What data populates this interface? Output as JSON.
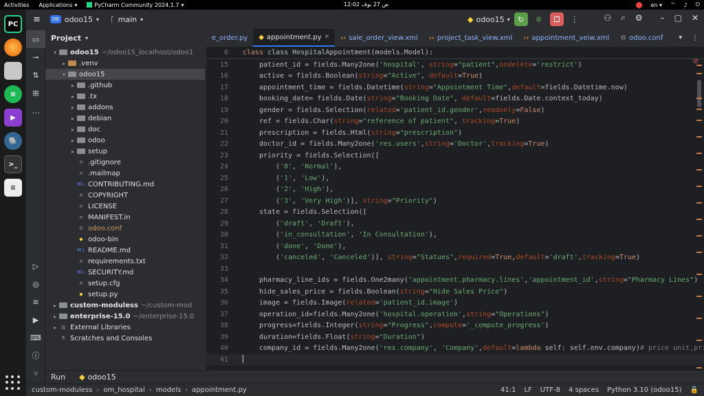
{
  "system_bar": {
    "activities": "Activities",
    "applications": "Applications",
    "active_app": "PyCharm Community 2024.1.7",
    "clock": "12:02 ص  27 نوف",
    "lang": "en"
  },
  "toolbar": {
    "project_badge": "OE",
    "project_name": "odoo15",
    "branch": "main",
    "run_config": "odoo15"
  },
  "project_panel": {
    "title": "Project",
    "tree": [
      {
        "indent": 0,
        "arrow": "▾",
        "kind": "folder",
        "label": "odoo15",
        "hint": "~/odoo15_localhost/odoo1",
        "bold": true
      },
      {
        "indent": 1,
        "arrow": "▸",
        "kind": "folder",
        "label": ".venv",
        "hint": "",
        "orange": true
      },
      {
        "indent": 1,
        "arrow": "▾",
        "kind": "folder",
        "label": "odoo15",
        "hint": "",
        "sel": true
      },
      {
        "indent": 2,
        "arrow": "▸",
        "kind": "folder",
        "label": ".github",
        "hint": ""
      },
      {
        "indent": 2,
        "arrow": "▸",
        "kind": "folder",
        "label": ".tx",
        "hint": ""
      },
      {
        "indent": 2,
        "arrow": "▸",
        "kind": "folder",
        "label": "addons",
        "hint": ""
      },
      {
        "indent": 2,
        "arrow": "▸",
        "kind": "folder",
        "label": "debian",
        "hint": ""
      },
      {
        "indent": 2,
        "arrow": "▸",
        "kind": "folder",
        "label": "doc",
        "hint": ""
      },
      {
        "indent": 2,
        "arrow": "▸",
        "kind": "folder",
        "label": "odoo",
        "hint": ""
      },
      {
        "indent": 2,
        "arrow": "▸",
        "kind": "folder",
        "label": "setup",
        "hint": ""
      },
      {
        "indent": 2,
        "arrow": "",
        "kind": "ignore",
        "label": ".gitignore",
        "hint": ""
      },
      {
        "indent": 2,
        "arrow": "",
        "kind": "text",
        "label": ".mailmap",
        "hint": ""
      },
      {
        "indent": 2,
        "arrow": "",
        "kind": "md",
        "label": "CONTRIBUTING.md",
        "hint": ""
      },
      {
        "indent": 2,
        "arrow": "",
        "kind": "text",
        "label": "COPYRIGHT",
        "hint": ""
      },
      {
        "indent": 2,
        "arrow": "",
        "kind": "text",
        "label": "LICENSE",
        "hint": ""
      },
      {
        "indent": 2,
        "arrow": "",
        "kind": "text",
        "label": "MANIFEST.in",
        "hint": ""
      },
      {
        "indent": 2,
        "arrow": "",
        "kind": "conf",
        "label": "odoo.conf",
        "hint": "",
        "orange": true
      },
      {
        "indent": 2,
        "arrow": "",
        "kind": "py",
        "label": "odoo-bin",
        "hint": ""
      },
      {
        "indent": 2,
        "arrow": "",
        "kind": "md",
        "label": "README.md",
        "hint": ""
      },
      {
        "indent": 2,
        "arrow": "",
        "kind": "text",
        "label": "requirements.txt",
        "hint": ""
      },
      {
        "indent": 2,
        "arrow": "",
        "kind": "md",
        "label": "SECURITY.md",
        "hint": ""
      },
      {
        "indent": 2,
        "arrow": "",
        "kind": "text",
        "label": "setup.cfg",
        "hint": ""
      },
      {
        "indent": 2,
        "arrow": "",
        "kind": "py",
        "label": "setup.py",
        "hint": ""
      },
      {
        "indent": 0,
        "arrow": "▸",
        "kind": "folder",
        "label": "custom-moduless",
        "hint": "~/custom-mod",
        "bold": true
      },
      {
        "indent": 0,
        "arrow": "▸",
        "kind": "folder",
        "label": "enterprise-15.0",
        "hint": "~/enterprise-15.0",
        "bold": true
      },
      {
        "indent": 0,
        "arrow": "▸",
        "kind": "lib",
        "label": "External Libraries",
        "hint": ""
      },
      {
        "indent": 0,
        "arrow": "",
        "kind": "scratch",
        "label": "Scratches and Consoles",
        "hint": ""
      }
    ]
  },
  "tabs": [
    {
      "label": "e_order.py",
      "icon": "",
      "active": false
    },
    {
      "label": "appointment.py",
      "icon": "py",
      "active": true
    },
    {
      "label": "sale_order_view.xml",
      "icon": "xml",
      "active": false
    },
    {
      "label": "project_task_view.xml",
      "icon": "xml",
      "active": false
    },
    {
      "label": "appointment_veiw.xml",
      "icon": "xml",
      "active": false
    },
    {
      "label": "odoo.conf",
      "icon": "conf",
      "active": false
    }
  ],
  "sticky": {
    "num": "6",
    "code": "class HospitalAppointment(models.Model):"
  },
  "code_lines": [
    {
      "n": "15",
      "html": "patient_id = fields.Many2one(<span class=\"s\">'hospital'</span>, <span class=\"p\">string</span>=<span class=\"s\">\"patient\"</span>,<span class=\"p\">ondelete</span>=<span class=\"s\">'restrict'</span>)"
    },
    {
      "n": "16",
      "html": "active = fields.Boolean(<span class=\"p\">string</span>=<span class=\"s\">\"Active\"</span>, <span class=\"p\">default</span>=<span class=\"k\">True</span>)"
    },
    {
      "n": "17",
      "html": "appointment_time = fields.Datetime(<span class=\"p\">string</span>=<span class=\"s\">\"Appointment Time\"</span>,<span class=\"p\">default</span>=fields.Datetime.now)"
    },
    {
      "n": "18",
      "html": "booking_date= fields.Date(<span class=\"p\">string</span>=<span class=\"s\">\"Booking Date\"</span>, <span class=\"p\">default</span>=fields.Date.context_today)"
    },
    {
      "n": "19",
      "html": "gender = fields.Selection(<span class=\"p\">related</span>=<span class=\"s\">'patient_id.gender'</span>,<span class=\"p\">readonly</span>=<span class=\"k\">False</span>)"
    },
    {
      "n": "20",
      "html": "ref = fields.Char(<span class=\"p\">string</span>=<span class=\"s\">\"reference of patient\"</span>, <span class=\"p\">tracking</span>=<span class=\"k\">True</span>)"
    },
    {
      "n": "21",
      "html": "prescription = fields.Html(<span class=\"p\">string</span>=<span class=\"s\">\"prescription\"</span>)"
    },
    {
      "n": "22",
      "html": "doctor_id = fields.Many2one(<span class=\"s\">'res.users'</span>,<span class=\"p\">string</span>=<span class=\"s\">'Doctor'</span>,<span class=\"p\">tracking</span>=<span class=\"k\">True</span>)"
    },
    {
      "n": "23",
      "html": "priority = fields.Selection(["
    },
    {
      "n": "24",
      "html": "    (<span class=\"s\">'0'</span>, <span class=\"s\">'Normal'</span>),"
    },
    {
      "n": "25",
      "html": "    (<span class=\"s\">'1'</span>, <span class=\"s\">'Low'</span>),"
    },
    {
      "n": "26",
      "html": "    (<span class=\"s\">'2'</span>, <span class=\"s\">'High'</span>),"
    },
    {
      "n": "27",
      "html": "    (<span class=\"s\">'3'</span>, <span class=\"s\">'Very High'</span>)], <span class=\"p\">string</span>=<span class=\"s\">\"Priority\"</span>)"
    },
    {
      "n": "28",
      "html": "state = fields.Selection(["
    },
    {
      "n": "29",
      "html": "    (<span class=\"s\">'draft'</span>, <span class=\"s\">'Draft'</span>),"
    },
    {
      "n": "30",
      "html": "    (<span class=\"s\">'in_consultation'</span>, <span class=\"s\">'In Consultation'</span>),"
    },
    {
      "n": "31",
      "html": "    (<span class=\"s\">'done'</span>, <span class=\"s\">'Done'</span>),"
    },
    {
      "n": "32",
      "html": "    (<span class=\"s\">'canceled'</span>, <span class=\"s\">'Canceled'</span>)], <span class=\"p\">string</span>=<span class=\"s\">\"Statues\"</span>,<span class=\"p\">required</span>=<span class=\"k\">True</span>,<span class=\"p\">default</span>=<span class=\"s\">'draft'</span>,<span class=\"p\">tracking</span>=<span class=\"k\">True</span>)"
    },
    {
      "n": "33",
      "html": ""
    },
    {
      "n": "34",
      "html": "pharmacy_line_ids = fields.One2many(<span class=\"s\">'appointment.pharmacy.lines'</span>,<span class=\"s\">'appointment_id'</span>,<span class=\"p\">string</span>=<span class=\"s\">\"Pharmacy Lines\"</span>)"
    },
    {
      "n": "35",
      "html": "hide_sales_price = fields.Boolean(<span class=\"p\">string</span>=<span class=\"s\">\"Hide Sales Price\"</span>)"
    },
    {
      "n": "36",
      "html": "image = fields.Image(<span class=\"p\">related</span>=<span class=\"s\">'patient_id.image'</span>)"
    },
    {
      "n": "37",
      "html": "operation_id=fields.Many2one(<span class=\"s\">'hospital.operation'</span>,<span class=\"p\">string</span>=<span class=\"s\">\"Operations\"</span>)"
    },
    {
      "n": "38",
      "html": "progress=fields.Integer(<span class=\"p\">string</span>=<span class=\"s\">\"Progress\"</span>,<span class=\"p\">compute</span>=<span class=\"s\">'_compute_progress'</span>)"
    },
    {
      "n": "39",
      "html": "duration=fields.Float(<span class=\"p\">string</span>=<span class=\"s\">\"Duration\"</span>)"
    },
    {
      "n": "40",
      "html": "company_id = fields.Many2one(<span class=\"s\">'res.company'</span>, <span class=\"s\">'Company'</span>,<span class=\"p\">default</span>=<span class=\"k\">lambda</span> self: self.env.company)<span class=\"c\"># price unit,price</span>"
    },
    {
      "n": "41",
      "html": "",
      "cursor": true
    }
  ],
  "run_bar": {
    "run_label": "Run",
    "config": "odoo15"
  },
  "status_bar": {
    "crumbs": [
      "custom-moduless",
      "om_hospital",
      "models",
      "appointment.py"
    ],
    "position": "41:1",
    "line_sep": "LF",
    "encoding": "UTF-8",
    "indent": "4 spaces",
    "interpreter": "Python 3.10 (odoo15)"
  },
  "colors": {
    "accent": "#3574f0",
    "run_green": "#5a9e4a",
    "stop_red": "#db5c5c"
  }
}
